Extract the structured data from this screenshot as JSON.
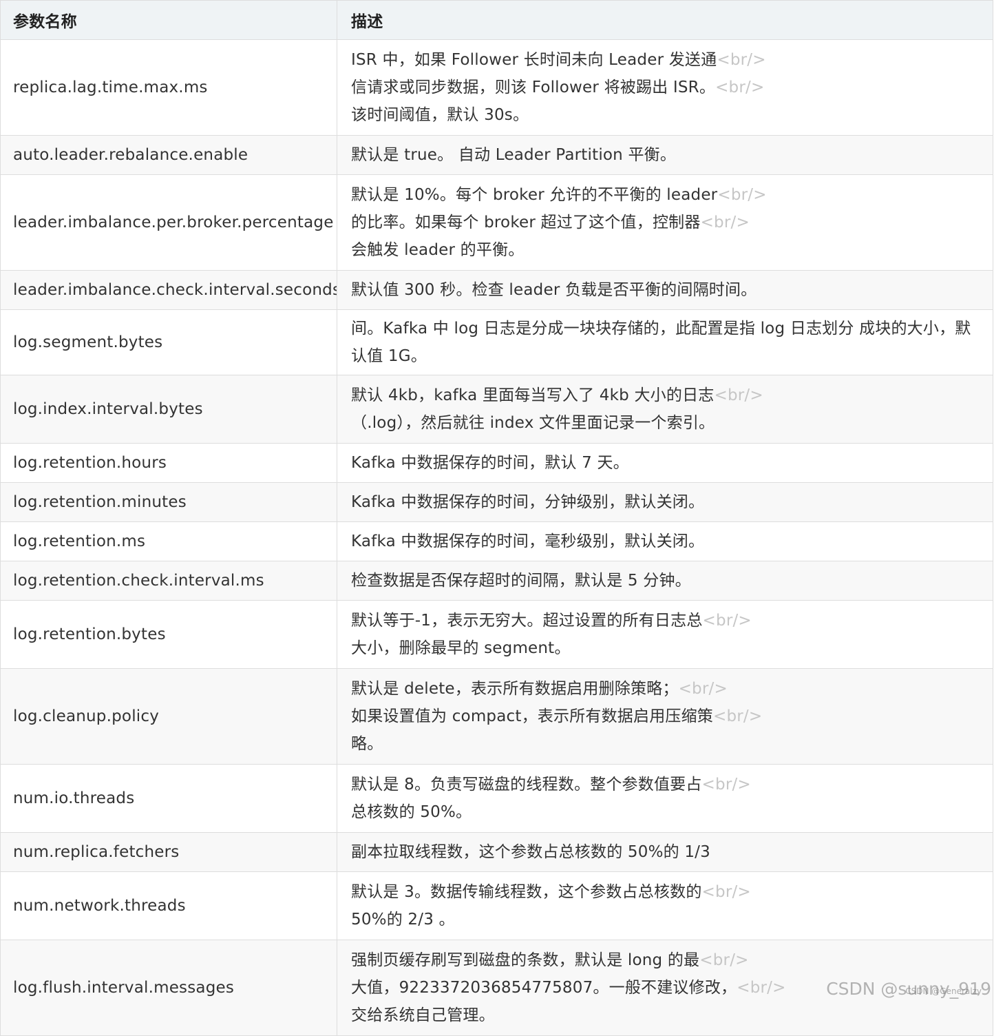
{
  "header": {
    "name_label": "参数名称",
    "desc_label": "描述"
  },
  "rows": [
    {
      "name": "replica.lag.time.max.ms",
      "lines": [
        {
          "text": "ISR 中，如果 Follower 长时间未向 Leader 发送通",
          "br": "<br/>"
        },
        {
          "text": "信请求或同步数据，则该 Follower 将被踢出 ISR。",
          "br": "<br/>"
        },
        {
          "text": "该时间阈值，默认 30s。",
          "br": ""
        }
      ]
    },
    {
      "name": "auto.leader.rebalance.enable",
      "lines": [
        {
          "text": "默认是 true。 自动 Leader Partition 平衡。",
          "br": ""
        }
      ]
    },
    {
      "name": "leader.imbalance.per.broker.percentage",
      "lines": [
        {
          "text": "默认是 10%。每个 broker 允许的不平衡的 leader",
          "br": "<br/>"
        },
        {
          "text": "的比率。如果每个 broker 超过了这个值，控制器",
          "br": "<br/>"
        },
        {
          "text": "会触发 leader 的平衡。",
          "br": ""
        }
      ]
    },
    {
      "name": "leader.imbalance.check.interval.seconds",
      "lines": [
        {
          "text": "默认值 300 秒。检查 leader 负载是否平衡的间隔时间。",
          "br": ""
        }
      ]
    },
    {
      "name": "log.segment.bytes",
      "wrap": true,
      "lines": [
        {
          "text": "间。Kafka 中 log 日志是分成一块块存储的，此配置是指 log 日志划分 成块的大小，默认值 1G。",
          "br": ""
        }
      ]
    },
    {
      "name": "log.index.interval.bytes",
      "lines": [
        {
          "text": "默认 4kb，kafka 里面每当写入了 4kb 大小的日志",
          "br": "<br/>"
        },
        {
          "text": "（.log），然后就往 index 文件里面记录一个索引。",
          "br": ""
        }
      ]
    },
    {
      "name": "log.retention.hours",
      "lines": [
        {
          "text": "Kafka 中数据保存的时间，默认 7 天。",
          "br": ""
        }
      ]
    },
    {
      "name": "log.retention.minutes",
      "lines": [
        {
          "text": "Kafka 中数据保存的时间，分钟级别，默认关闭。",
          "br": ""
        }
      ]
    },
    {
      "name": "log.retention.ms",
      "lines": [
        {
          "text": "Kafka 中数据保存的时间，毫秒级别，默认关闭。",
          "br": ""
        }
      ]
    },
    {
      "name": "log.retention.check.interval.ms",
      "lines": [
        {
          "text": "检查数据是否保存超时的间隔，默认是 5 分钟。",
          "br": ""
        }
      ]
    },
    {
      "name": "log.retention.bytes",
      "lines": [
        {
          "text": "默认等于-1，表示无穷大。超过设置的所有日志总",
          "br": "<br/>"
        },
        {
          "text": "大小，删除最早的 segment。",
          "br": ""
        }
      ]
    },
    {
      "name": "log.cleanup.policy",
      "lines": [
        {
          "text": "默认是 delete，表示所有数据启用删除策略；",
          "br": "<br/>"
        },
        {
          "text": "如果设置值为 compact，表示所有数据启用压缩策",
          "br": "<br/>"
        },
        {
          "text": "略。",
          "br": ""
        }
      ]
    },
    {
      "name": "num.io.threads",
      "lines": [
        {
          "text": "默认是 8。负责写磁盘的线程数。整个参数值要占",
          "br": "<br/>"
        },
        {
          "text": "总核数的 50%。",
          "br": ""
        }
      ]
    },
    {
      "name": "num.replica.fetchers",
      "lines": [
        {
          "text": "副本拉取线程数，这个参数占总核数的 50%的 1/3",
          "br": ""
        }
      ]
    },
    {
      "name": "num.network.threads",
      "lines": [
        {
          "text": "默认是 3。数据传输线程数，这个参数占总核数的",
          "br": "<br/>"
        },
        {
          "text": "50%的 2/3 。",
          "br": ""
        }
      ]
    },
    {
      "name": "log.flush.interval.messages",
      "lines": [
        {
          "text": "强制页缓存刷写到磁盘的条数，默认是 long 的最",
          "br": "<br/>"
        },
        {
          "text": "大值，9223372036854775807。一般不建议修改，",
          "br": "<br/>"
        },
        {
          "text": "交给系统自己管理。",
          "br": ""
        }
      ]
    }
  ],
  "watermark": {
    "main": "CSDN @sunny_919",
    "small": "CSDN @Generalzy"
  }
}
